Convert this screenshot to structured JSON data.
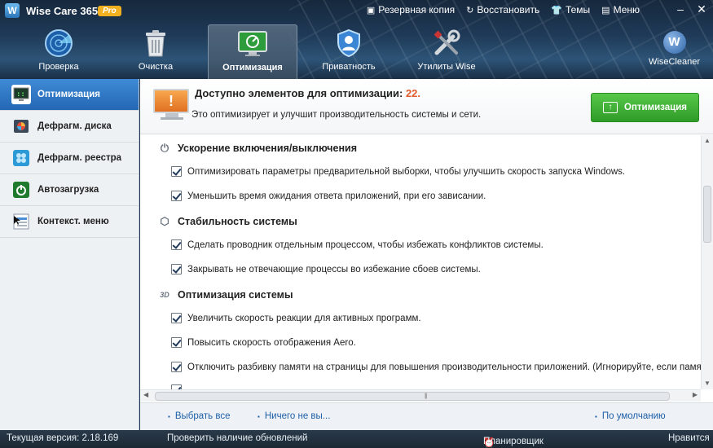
{
  "app": {
    "logo": "W",
    "title": "Wise Care 365",
    "badge": "Pro"
  },
  "top_menu": [
    {
      "icon": "save-icon",
      "glyph": "▣",
      "label": "Резервная копия"
    },
    {
      "icon": "restore-icon",
      "glyph": "↻",
      "label": "Восстановить"
    },
    {
      "icon": "tshirt-icon",
      "glyph": "👕",
      "label": "Темы"
    },
    {
      "icon": "menu-icon",
      "glyph": "▤",
      "label": "Меню"
    }
  ],
  "window_controls": {
    "minimize": "–",
    "close": "✕"
  },
  "nav": [
    {
      "label": "Проверка",
      "icon": "radar-icon"
    },
    {
      "label": "Очистка",
      "icon": "trash-icon"
    },
    {
      "label": "Оптимизация",
      "icon": "monitor-optimize-icon",
      "active": true
    },
    {
      "label": "Приватность",
      "icon": "shield-user-icon"
    },
    {
      "label": "Утилиты Wise",
      "icon": "tools-icon"
    }
  ],
  "wisecleaner": {
    "letter": "W",
    "label": "WiseCleaner"
  },
  "sidebar": [
    {
      "label": "Оптимизация",
      "icon": "optimize-icon",
      "active": true
    },
    {
      "label": "Дефрагм. диска",
      "icon": "disk-defrag-icon"
    },
    {
      "label": "Дефрагм. реестра",
      "icon": "registry-defrag-icon"
    },
    {
      "label": "Автозагрузка",
      "icon": "power-icon"
    },
    {
      "label": "Контекст. меню",
      "icon": "context-menu-icon"
    }
  ],
  "banner": {
    "title_prefix": "Доступно элементов для оптимизации:",
    "count": "22.",
    "subtitle": "Это оптимизирует и улучшит производительность системы и сети.",
    "button_label": "Оптимизация"
  },
  "sections": [
    {
      "title": "Ускорение включения/выключения",
      "icon": "power-icon",
      "items": [
        {
          "label": "Оптимизировать параметры предварительной выборки, чтобы улучшить скорость запуска Windows.",
          "checked": true
        },
        {
          "label": "Уменьшить время ожидания ответа приложений, при его зависании.",
          "checked": true
        }
      ]
    },
    {
      "title": "Стабильность системы",
      "icon": "cube-icon",
      "items": [
        {
          "label": "Сделать проводник отдельным процессом, чтобы избежать конфликтов системы.",
          "checked": true
        },
        {
          "label": "Закрывать не отвечающие процессы во избежание сбоев системы.",
          "checked": true
        }
      ]
    },
    {
      "title": "Оптимизация системы",
      "icon": "3d-icon",
      "items": [
        {
          "label": "Увеличить скорость реакции для активных программ.",
          "checked": true
        },
        {
          "label": "Повысить скорость отображения Aero.",
          "checked": true
        },
        {
          "label": "Отключить разбивку памяти на страницы для повышения производительности приложений. (Игнорируйте, если памяти <",
          "checked": true
        }
      ]
    }
  ],
  "footer_links": {
    "select_all": "Выбрать все",
    "select_none": "Ничего не вы...",
    "default": "По умолчанию"
  },
  "statusbar": {
    "version": "Текущая версия: 2.18.169",
    "check_updates": "Проверить наличие обновлений",
    "scheduler": "Планировщик неактивен",
    "like": "Нравится"
  }
}
